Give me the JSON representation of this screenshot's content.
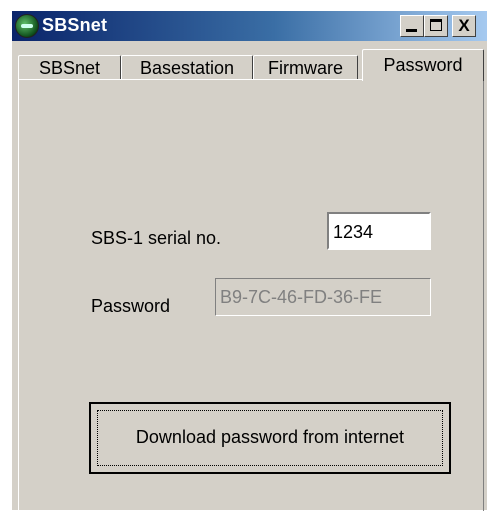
{
  "window": {
    "title": "SBSnet",
    "min_label": "_",
    "close_label": "X"
  },
  "tabs": [
    {
      "label": "SBSnet"
    },
    {
      "label": "Basestation"
    },
    {
      "label": "Firmware"
    },
    {
      "label": "Password",
      "selected": true
    }
  ],
  "form": {
    "serial_label": "SBS-1 serial no.",
    "serial_value": "1234",
    "password_label": "Password",
    "password_value": "B9-7C-46-FD-36-FE"
  },
  "actions": {
    "download_label": "Download password from internet"
  },
  "colors": {
    "face": "#d4d0c8",
    "title_start": "#0a246a",
    "title_end": "#a6caf0"
  }
}
